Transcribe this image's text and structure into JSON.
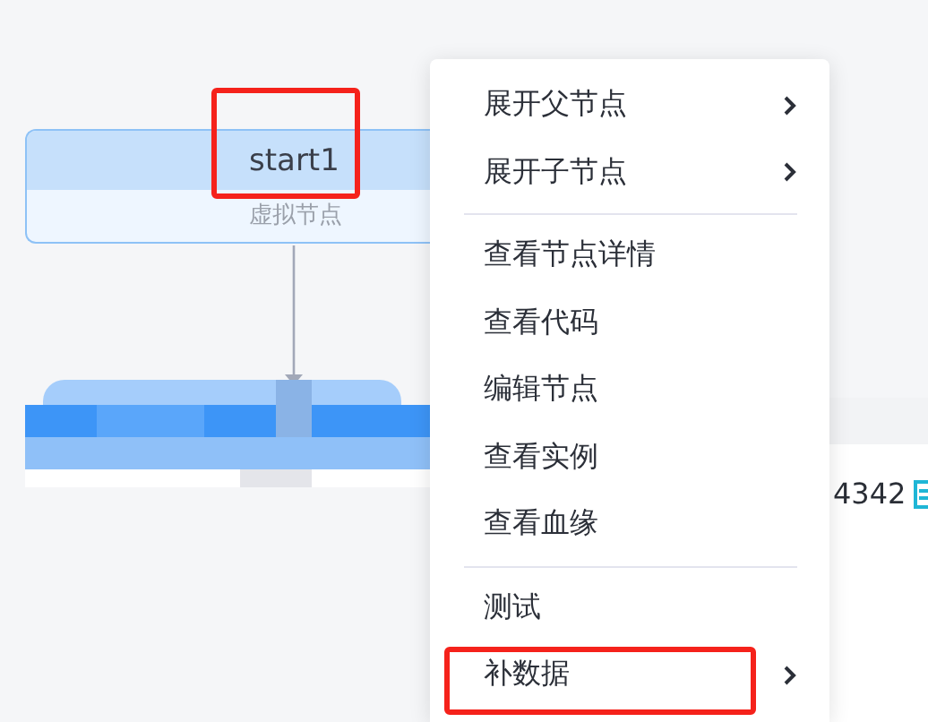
{
  "canvas": {
    "node": {
      "title": "start1",
      "subtitle": "虚拟节点",
      "highlighted": true
    }
  },
  "side_panel": {
    "value": "4342"
  },
  "context_menu": {
    "groups": [
      {
        "items": [
          {
            "label": "展开父节点",
            "submenu": true,
            "highlighted": false
          },
          {
            "label": "展开子节点",
            "submenu": true,
            "highlighted": false
          }
        ]
      },
      {
        "items": [
          {
            "label": "查看节点详情",
            "submenu": false,
            "highlighted": false
          },
          {
            "label": "查看代码",
            "submenu": false,
            "highlighted": false
          },
          {
            "label": "编辑节点",
            "submenu": false,
            "highlighted": false
          },
          {
            "label": "查看实例",
            "submenu": false,
            "highlighted": false
          },
          {
            "label": "查看血缘",
            "submenu": false,
            "highlighted": false
          }
        ]
      },
      {
        "items": [
          {
            "label": "测试",
            "submenu": false,
            "highlighted": false
          },
          {
            "label": "补数据",
            "submenu": true,
            "highlighted": true
          }
        ]
      }
    ]
  }
}
